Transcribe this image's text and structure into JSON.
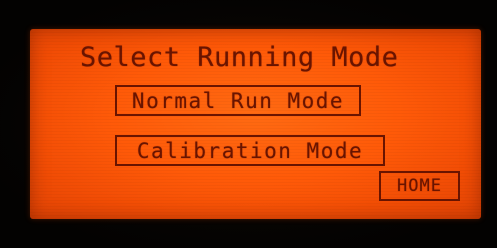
{
  "screen": {
    "title": "Select Running Mode"
  },
  "buttons": {
    "normal_run": "Normal Run Mode",
    "calibration": "Calibration Mode",
    "home": "HOME"
  },
  "colors": {
    "backlight": "#ff5a08",
    "text": "#6a1400",
    "bezel": "#050302"
  }
}
